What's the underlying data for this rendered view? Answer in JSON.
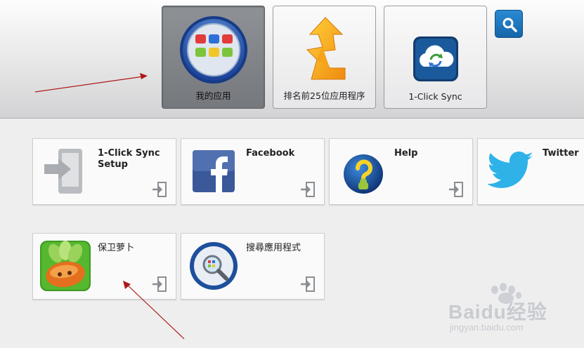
{
  "header": {
    "tabs": [
      {
        "label": "我的应用",
        "icon": "app-grid-icon",
        "active": true
      },
      {
        "label": "排名前25位应用程序",
        "icon": "top-chart-arrow-icon",
        "active": false
      },
      {
        "label": "1-Click Sync",
        "icon": "cloud-sync-icon",
        "active": false
      }
    ],
    "search_icon": "search-icon"
  },
  "apps": [
    {
      "title": "1-Click Sync Setup",
      "icon": "sync-setup-icon"
    },
    {
      "title": "Facebook",
      "icon": "facebook-icon"
    },
    {
      "title": "Help",
      "icon": "help-icon"
    },
    {
      "title": "Twitter",
      "icon": "twitter-icon"
    },
    {
      "title": "保卫萝卜",
      "icon": "carrot-game-icon"
    },
    {
      "title": "搜尋應用程式",
      "icon": "search-apps-icon"
    }
  ],
  "watermark": {
    "brand": "Baidu经验",
    "url": "jingyan.baidu.com"
  },
  "colors": {
    "annotation_arrow": "#b01818",
    "accent_blue": "#1b74c0",
    "active_tab": "#7f8287"
  }
}
